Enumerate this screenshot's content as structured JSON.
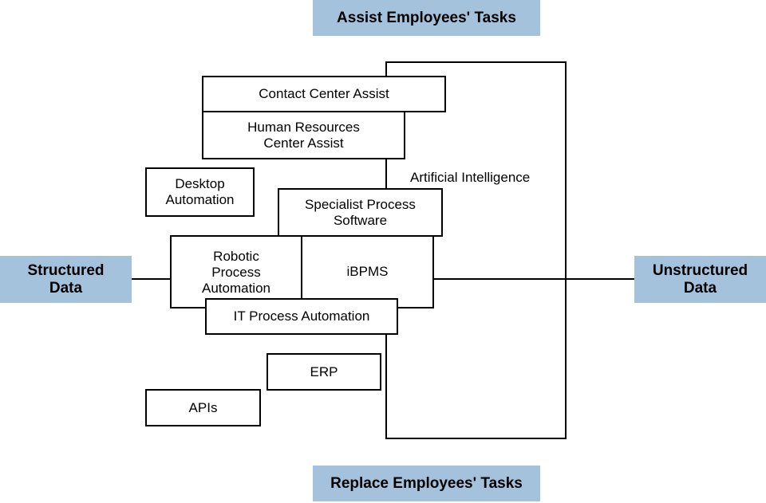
{
  "diagram": {
    "axes": {
      "top": "Assist Employees' Tasks",
      "bottom": "Replace Employees' Tasks",
      "left": "Structured\nData",
      "right": "Unstructured\nData"
    },
    "region_label": "Artificial Intelligence",
    "boxes": {
      "contact_center": "Contact Center Assist",
      "hr_center": "Human Resources\nCenter Assist",
      "desktop": "Desktop\nAutomation",
      "specialist": "Specialist Process\nSoftware",
      "rpa": "Robotic\nProcess\nAutomation",
      "ibpms": "iBPMS",
      "itpa": "IT Process Automation",
      "erp": "ERP",
      "apis": "APIs"
    },
    "colors": {
      "axis_label_bg": "#a4c2db",
      "stroke": "#000000"
    }
  }
}
